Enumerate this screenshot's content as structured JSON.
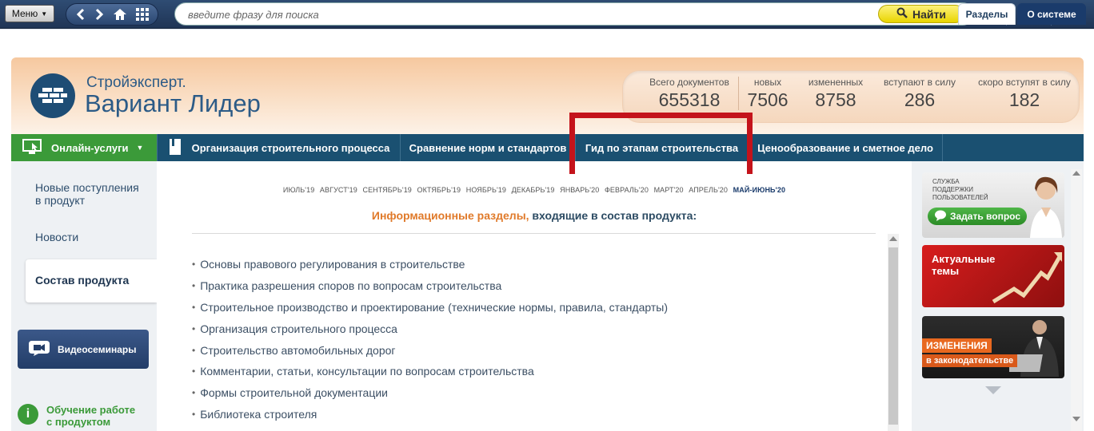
{
  "toolbar": {
    "menu_label": "Меню",
    "search_placeholder": "введите фразу для поиска",
    "find_label": "Найти",
    "icons": [
      "back-icon",
      "forward-icon",
      "home-icon",
      "grid-icon",
      "search-icon",
      "hamburger-icon",
      "user-icon",
      "help-icon"
    ]
  },
  "tabs": [
    "Разделы",
    "О системе"
  ],
  "logo": {
    "line1": "Стройэксперт.",
    "line2": "Вариант Лидер"
  },
  "stats": [
    {
      "label": "Всего документов",
      "value": "655318"
    },
    {
      "label": "новых",
      "value": "7506"
    },
    {
      "label": "измененных",
      "value": "8758"
    },
    {
      "label": "вступают в силу",
      "value": "286"
    },
    {
      "label": "скоро вступят в силу",
      "value": "182"
    }
  ],
  "nav": {
    "online": "Онлайн-услуги",
    "items": [
      "Организация строительного процесса",
      "Сравнение норм и стандартов",
      "Гид по этапам строительства",
      "Ценообразование и сметное дело"
    ]
  },
  "sidebar": {
    "items": [
      "Новые поступления в продукт",
      "Новости",
      "Состав продукта"
    ],
    "video_label": "Видеосеминары",
    "training_line1": "Обучение работе",
    "training_line2": "с продуктом"
  },
  "months": [
    "ИЮЛЬ'19",
    "АВГУСТ'19",
    "СЕНТЯБРЬ'19",
    "ОКТЯБРЬ'19",
    "НОЯБРЬ'19",
    "ДЕКАБРЬ'19",
    "ЯНВАРЬ'20",
    "ФЕВРАЛЬ'20",
    "МАРТ'20",
    "АПРЕЛЬ'20",
    "МАЙ-ИЮНЬ'20"
  ],
  "info": {
    "title_orange": "Информационные разделы,",
    "title_rest": " входящие в состав продукта:",
    "list": [
      "Основы правового регулирования в строительстве",
      "Практика разрешения споров по вопросам строительства",
      "Строительное производство и проектирование (технические нормы, правила, стандарты)",
      "Организация строительного процесса",
      "Строительство автомобильных дорог",
      "Комментарии, статьи, консультации по вопросам строительства",
      "Формы строительной документации",
      "Библиотека строителя"
    ]
  },
  "banners": {
    "support_line1": "СЛУЖБА",
    "support_line2": "ПОДДЕРЖКИ",
    "support_line3": "ПОЛЬЗОВАТЕЛЕЙ",
    "ask_label": "Задать вопрос",
    "topics_line1": "Актуальные",
    "topics_line2": "темы",
    "changes_a": "ИЗМЕНЕНИЯ",
    "changes_b": "в законодательстве"
  },
  "colors": {
    "highlight": "#c4131b",
    "nav": "#1a5071",
    "online": "#3b9a39",
    "accent_orange": "#e07a2a"
  }
}
